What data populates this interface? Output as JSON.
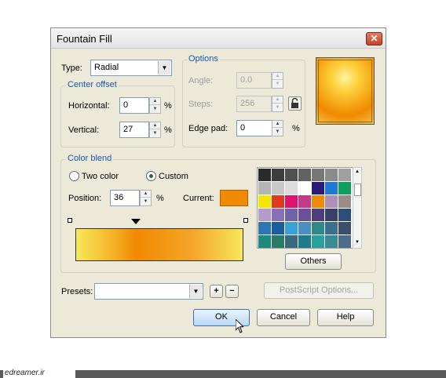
{
  "dialog": {
    "title": "Fountain Fill",
    "close_glyph": "✕"
  },
  "type": {
    "label": "Type:",
    "value": "Radial"
  },
  "center_offset": {
    "title": "Center offset",
    "horizontal_label": "Horizontal:",
    "horizontal_value": "0",
    "vertical_label": "Vertical:",
    "vertical_value": "27",
    "unit": "%"
  },
  "options": {
    "title": "Options",
    "angle_label": "Angle:",
    "angle_value": "0.0",
    "steps_label": "Steps:",
    "steps_value": "256",
    "edge_pad_label": "Edge pad:",
    "edge_pad_value": "0",
    "unit": "%"
  },
  "color_blend": {
    "title": "Color blend",
    "two_color_label": "Two color",
    "custom_label": "Custom",
    "selected_mode": "custom",
    "position_label": "Position:",
    "position_value": "36",
    "position_unit": "%",
    "current_label": "Current:",
    "current_color": "#f08a00",
    "others_label": "Others",
    "palette": [
      "#2b2b2b",
      "#3d3d3d",
      "#505050",
      "#626262",
      "#777777",
      "#8b8b8b",
      "#a0a0a0",
      "#b5b5b5",
      "#c8c8c8",
      "#dcdcdc",
      "#ffffff",
      "#2a1a7a",
      "#1f78d1",
      "#0f9f5b",
      "#f5e600",
      "#e03a1e",
      "#e0126e",
      "#c23b8a",
      "#f08a00",
      "#ae8fb8",
      "#9a8d88",
      "#b39ad0",
      "#8a70b8",
      "#6f62a8",
      "#6a4f9a",
      "#4d3d7a",
      "#3a3f6a",
      "#2e4e7a",
      "#2e75b6",
      "#1c5d9e",
      "#3aa0d8",
      "#4a8fc0",
      "#2e8a8a",
      "#3c6e8f",
      "#3b4f6a",
      "#1e8a7a",
      "#2a7a6a",
      "#3a6a7a",
      "#1f7a8a",
      "#2a9fa0",
      "#3a8a96",
      "#4b6d86"
    ]
  },
  "presets": {
    "label": "Presets:",
    "value": "",
    "add_glyph": "+",
    "remove_glyph": "−"
  },
  "postscript_options_label": "PostScript Options...",
  "buttons": {
    "ok": "OK",
    "cancel": "Cancel",
    "help": "Help"
  },
  "watermark": "edreamer.ir",
  "icons": {
    "lock": "lock-icon",
    "close": "close-icon",
    "cursor": "mouse-cursor-icon"
  }
}
